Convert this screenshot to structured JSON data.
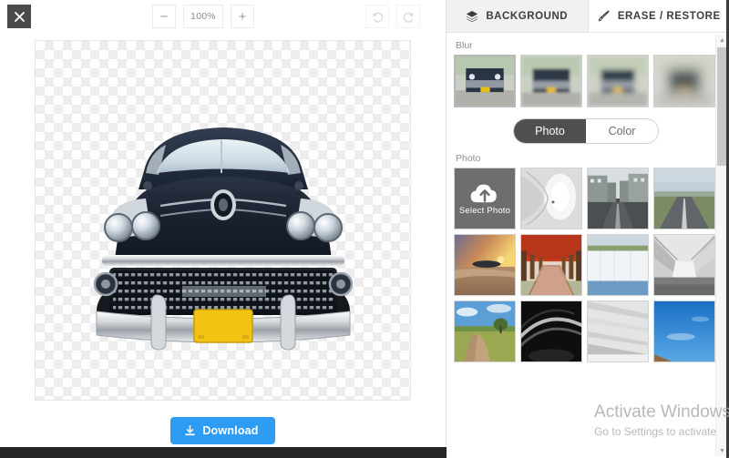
{
  "editor": {
    "close_label": "✕",
    "close_icon": "close-icon",
    "zoom": {
      "minus_label": "−",
      "level": "100%",
      "plus_label": "+"
    },
    "history": {
      "undo_icon": "undo-icon",
      "redo_icon": "redo-icon"
    },
    "canvas": {
      "subject": "classic car cutout on transparent checkerboard",
      "transparency_color_light": "#ffffff",
      "transparency_color_dark": "#ededed"
    },
    "download": {
      "label": "Download",
      "icon": "download-icon",
      "color": "#2f9cf4"
    }
  },
  "panel": {
    "tabs": [
      {
        "label": "BACKGROUND",
        "icon": "layers-icon",
        "active": false
      },
      {
        "label": "ERASE / RESTORE",
        "icon": "brush-icon",
        "active": true
      }
    ],
    "blur": {
      "label": "Blur",
      "items": [
        {
          "name": "blur-none",
          "level": 0,
          "selected": true
        },
        {
          "name": "blur-low",
          "level": 1,
          "selected": false
        },
        {
          "name": "blur-medium",
          "level": 2,
          "selected": false
        },
        {
          "name": "blur-high",
          "level": 3,
          "selected": false
        }
      ]
    },
    "source_toggle": {
      "photo_label": "Photo",
      "color_label": "Color",
      "selected": "Photo"
    },
    "photo": {
      "label": "Photo",
      "select_photo_label": "Select Photo",
      "select_photo_icon": "cloud-upload-icon",
      "items": [
        {
          "name": "photo-white-tunnel",
          "alt": "white curved tunnel"
        },
        {
          "name": "photo-city-street",
          "alt": "city street with buildings"
        },
        {
          "name": "photo-open-road",
          "alt": "open road through green fields"
        },
        {
          "name": "photo-beach-sunset",
          "alt": "beach sunset with island"
        },
        {
          "name": "photo-autumn-avenue",
          "alt": "red autumn tree avenue"
        },
        {
          "name": "photo-white-wall",
          "alt": "white wall and water"
        },
        {
          "name": "photo-grey-corridor",
          "alt": "grey geometric corridor"
        },
        {
          "name": "photo-country-road",
          "alt": "country road with blue sky"
        },
        {
          "name": "photo-dark-arc",
          "alt": "dark arched lights"
        },
        {
          "name": "photo-light-ceiling",
          "alt": "light ceiling lines"
        },
        {
          "name": "photo-blue-sky",
          "alt": "bright blue sky"
        }
      ]
    },
    "scrollbar": {
      "up_arrow": "▲",
      "down_arrow": "▼"
    }
  },
  "watermark": {
    "line1": "Activate Windows",
    "line2": "Go to Settings to activate"
  }
}
